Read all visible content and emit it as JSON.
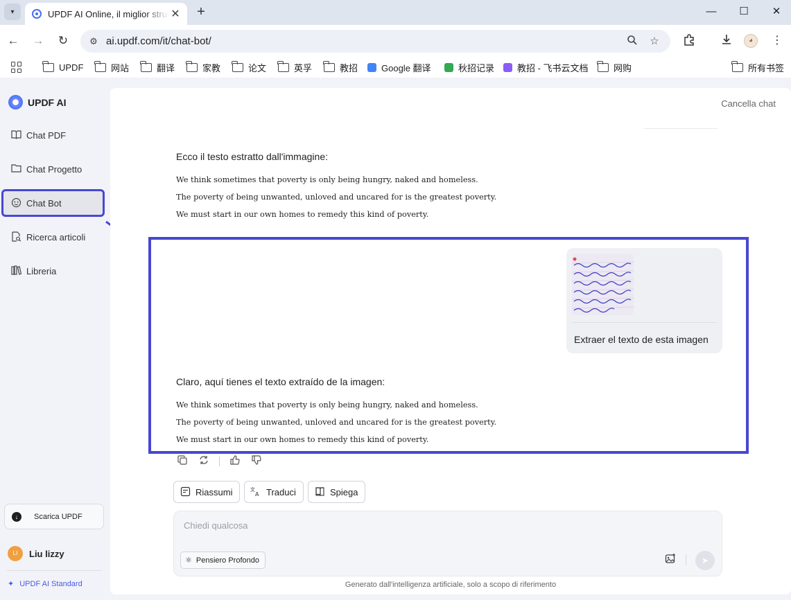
{
  "browser": {
    "tab_title": "UPDF AI Online, il miglior strumento AI",
    "tab_close": "✕",
    "new_tab": "+",
    "window": {
      "minimize": "—",
      "maximize": "☐",
      "close": "✕"
    },
    "nav": {
      "back": "←",
      "forward": "→",
      "reload": "↻"
    },
    "url": "ai.updf.com/it/chat-bot/",
    "bookmarks": [
      {
        "label": "UPDF",
        "icon": "folder-icon"
      },
      {
        "label": "网站",
        "icon": "folder-icon"
      },
      {
        "label": "翻译",
        "icon": "folder-icon"
      },
      {
        "label": "家教",
        "icon": "folder-icon"
      },
      {
        "label": "论文",
        "icon": "folder-icon"
      },
      {
        "label": "英孚",
        "icon": "folder-icon"
      },
      {
        "label": "教招",
        "icon": "folder-icon"
      },
      {
        "label": "Google 翻译",
        "icon": "google-translate-icon",
        "color": "#4285f4"
      },
      {
        "label": "秋招记录",
        "icon": "sheet-icon",
        "color": "#34a853"
      },
      {
        "label": "教招 - 飞书云文档",
        "icon": "feishu-icon",
        "color": "#8b5cf6"
      },
      {
        "label": "网购",
        "icon": "folder-icon"
      }
    ],
    "all_bookmarks": "所有书签"
  },
  "sidebar": {
    "brand": "UPDF AI",
    "items": [
      {
        "label": "Chat PDF",
        "icon": "book-icon"
      },
      {
        "label": "Chat Progetto",
        "icon": "folder-icon"
      },
      {
        "label": "Chat Bot",
        "icon": "bot-icon",
        "active": true
      },
      {
        "label": "Ricerca articoli",
        "icon": "search-doc-icon"
      },
      {
        "label": "Libreria",
        "icon": "library-icon"
      }
    ],
    "download_label": "Scarica UPDF",
    "user": {
      "initials": "LI",
      "name": "Liu lizzy"
    },
    "plan": "UPDF AI Standard"
  },
  "chat": {
    "cancel_label": "Cancella chat",
    "messages": [
      {
        "role": "assistant",
        "intro": "Ecco il testo estratto dall'immagine:",
        "lines": [
          "We think sometimes that poverty is only being hungry, naked and homeless.",
          "The poverty of being unwanted, unloved and uncared for is the greatest poverty.",
          "We must start in our own homes to remedy this kind of poverty."
        ]
      },
      {
        "role": "user",
        "text": "Extraer el texto de esta imagen",
        "image_icon": "handwritten-note-thumbnail"
      },
      {
        "role": "assistant",
        "intro": "Claro, aquí tienes el texto extraído de la imagen:",
        "lines": [
          "We think sometimes that poverty is only being hungry, naked and homeless.",
          "The poverty of being unwanted, unloved and uncared for is the greatest poverty.",
          "We must start in our own homes to remedy this kind of poverty."
        ]
      }
    ],
    "quick_actions": [
      {
        "label": "Riassumi",
        "icon": "summary-icon"
      },
      {
        "label": "Traduci",
        "icon": "translate-icon"
      },
      {
        "label": "Spiega",
        "icon": "book-open-icon"
      }
    ],
    "composer": {
      "placeholder": "Chiedi qualcosa",
      "value": "",
      "deep_label": "Pensiero Profondo"
    },
    "disclaimer": "Generato dall'intelligenza artificiale, solo a scopo di riferimento"
  },
  "colors": {
    "accent": "#4747d1",
    "brand": "#3f5fe6",
    "avatar": "#f0a040"
  }
}
